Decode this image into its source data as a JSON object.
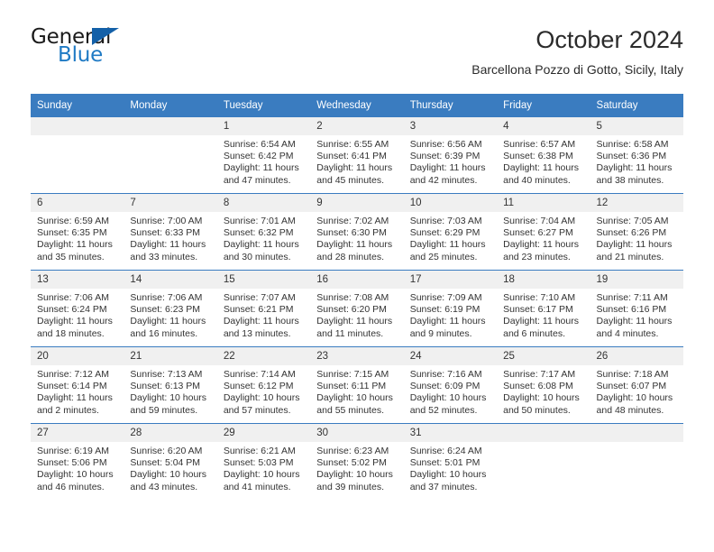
{
  "brand": {
    "word_one": "General",
    "word_two": "Blue",
    "triangle_icon": "triangle-icon",
    "colors": {
      "dark": "#1a1a1a",
      "blue": "#1f7ac4",
      "triangle": "#1360a8"
    }
  },
  "header": {
    "title": "October 2024",
    "subtitle": "Barcellona Pozzo di Gotto, Sicily, Italy"
  },
  "theme": {
    "header_blue": "#3a7cc0",
    "daynum_band": "#f0f0f0",
    "text": "#333333"
  },
  "labels": {
    "sunrise_prefix": "Sunrise:",
    "sunset_prefix": "Sunset:",
    "daylight_prefix": "Daylight:"
  },
  "weekday_headers": [
    "Sunday",
    "Monday",
    "Tuesday",
    "Wednesday",
    "Thursday",
    "Friday",
    "Saturday"
  ],
  "weeks": [
    [
      {
        "day": ""
      },
      {
        "day": ""
      },
      {
        "day": "1",
        "sunrise": "Sunrise: 6:54 AM",
        "sunset": "Sunset: 6:42 PM",
        "daylight_line1": "Daylight: 11 hours",
        "daylight_line2": "and 47 minutes."
      },
      {
        "day": "2",
        "sunrise": "Sunrise: 6:55 AM",
        "sunset": "Sunset: 6:41 PM",
        "daylight_line1": "Daylight: 11 hours",
        "daylight_line2": "and 45 minutes."
      },
      {
        "day": "3",
        "sunrise": "Sunrise: 6:56 AM",
        "sunset": "Sunset: 6:39 PM",
        "daylight_line1": "Daylight: 11 hours",
        "daylight_line2": "and 42 minutes."
      },
      {
        "day": "4",
        "sunrise": "Sunrise: 6:57 AM",
        "sunset": "Sunset: 6:38 PM",
        "daylight_line1": "Daylight: 11 hours",
        "daylight_line2": "and 40 minutes."
      },
      {
        "day": "5",
        "sunrise": "Sunrise: 6:58 AM",
        "sunset": "Sunset: 6:36 PM",
        "daylight_line1": "Daylight: 11 hours",
        "daylight_line2": "and 38 minutes."
      }
    ],
    [
      {
        "day": "6",
        "sunrise": "Sunrise: 6:59 AM",
        "sunset": "Sunset: 6:35 PM",
        "daylight_line1": "Daylight: 11 hours",
        "daylight_line2": "and 35 minutes."
      },
      {
        "day": "7",
        "sunrise": "Sunrise: 7:00 AM",
        "sunset": "Sunset: 6:33 PM",
        "daylight_line1": "Daylight: 11 hours",
        "daylight_line2": "and 33 minutes."
      },
      {
        "day": "8",
        "sunrise": "Sunrise: 7:01 AM",
        "sunset": "Sunset: 6:32 PM",
        "daylight_line1": "Daylight: 11 hours",
        "daylight_line2": "and 30 minutes."
      },
      {
        "day": "9",
        "sunrise": "Sunrise: 7:02 AM",
        "sunset": "Sunset: 6:30 PM",
        "daylight_line1": "Daylight: 11 hours",
        "daylight_line2": "and 28 minutes."
      },
      {
        "day": "10",
        "sunrise": "Sunrise: 7:03 AM",
        "sunset": "Sunset: 6:29 PM",
        "daylight_line1": "Daylight: 11 hours",
        "daylight_line2": "and 25 minutes."
      },
      {
        "day": "11",
        "sunrise": "Sunrise: 7:04 AM",
        "sunset": "Sunset: 6:27 PM",
        "daylight_line1": "Daylight: 11 hours",
        "daylight_line2": "and 23 minutes."
      },
      {
        "day": "12",
        "sunrise": "Sunrise: 7:05 AM",
        "sunset": "Sunset: 6:26 PM",
        "daylight_line1": "Daylight: 11 hours",
        "daylight_line2": "and 21 minutes."
      }
    ],
    [
      {
        "day": "13",
        "sunrise": "Sunrise: 7:06 AM",
        "sunset": "Sunset: 6:24 PM",
        "daylight_line1": "Daylight: 11 hours",
        "daylight_line2": "and 18 minutes."
      },
      {
        "day": "14",
        "sunrise": "Sunrise: 7:06 AM",
        "sunset": "Sunset: 6:23 PM",
        "daylight_line1": "Daylight: 11 hours",
        "daylight_line2": "and 16 minutes."
      },
      {
        "day": "15",
        "sunrise": "Sunrise: 7:07 AM",
        "sunset": "Sunset: 6:21 PM",
        "daylight_line1": "Daylight: 11 hours",
        "daylight_line2": "and 13 minutes."
      },
      {
        "day": "16",
        "sunrise": "Sunrise: 7:08 AM",
        "sunset": "Sunset: 6:20 PM",
        "daylight_line1": "Daylight: 11 hours",
        "daylight_line2": "and 11 minutes."
      },
      {
        "day": "17",
        "sunrise": "Sunrise: 7:09 AM",
        "sunset": "Sunset: 6:19 PM",
        "daylight_line1": "Daylight: 11 hours",
        "daylight_line2": "and 9 minutes."
      },
      {
        "day": "18",
        "sunrise": "Sunrise: 7:10 AM",
        "sunset": "Sunset: 6:17 PM",
        "daylight_line1": "Daylight: 11 hours",
        "daylight_line2": "and 6 minutes."
      },
      {
        "day": "19",
        "sunrise": "Sunrise: 7:11 AM",
        "sunset": "Sunset: 6:16 PM",
        "daylight_line1": "Daylight: 11 hours",
        "daylight_line2": "and 4 minutes."
      }
    ],
    [
      {
        "day": "20",
        "sunrise": "Sunrise: 7:12 AM",
        "sunset": "Sunset: 6:14 PM",
        "daylight_line1": "Daylight: 11 hours",
        "daylight_line2": "and 2 minutes."
      },
      {
        "day": "21",
        "sunrise": "Sunrise: 7:13 AM",
        "sunset": "Sunset: 6:13 PM",
        "daylight_line1": "Daylight: 10 hours",
        "daylight_line2": "and 59 minutes."
      },
      {
        "day": "22",
        "sunrise": "Sunrise: 7:14 AM",
        "sunset": "Sunset: 6:12 PM",
        "daylight_line1": "Daylight: 10 hours",
        "daylight_line2": "and 57 minutes."
      },
      {
        "day": "23",
        "sunrise": "Sunrise: 7:15 AM",
        "sunset": "Sunset: 6:11 PM",
        "daylight_line1": "Daylight: 10 hours",
        "daylight_line2": "and 55 minutes."
      },
      {
        "day": "24",
        "sunrise": "Sunrise: 7:16 AM",
        "sunset": "Sunset: 6:09 PM",
        "daylight_line1": "Daylight: 10 hours",
        "daylight_line2": "and 52 minutes."
      },
      {
        "day": "25",
        "sunrise": "Sunrise: 7:17 AM",
        "sunset": "Sunset: 6:08 PM",
        "daylight_line1": "Daylight: 10 hours",
        "daylight_line2": "and 50 minutes."
      },
      {
        "day": "26",
        "sunrise": "Sunrise: 7:18 AM",
        "sunset": "Sunset: 6:07 PM",
        "daylight_line1": "Daylight: 10 hours",
        "daylight_line2": "and 48 minutes."
      }
    ],
    [
      {
        "day": "27",
        "sunrise": "Sunrise: 6:19 AM",
        "sunset": "Sunset: 5:06 PM",
        "daylight_line1": "Daylight: 10 hours",
        "daylight_line2": "and 46 minutes."
      },
      {
        "day": "28",
        "sunrise": "Sunrise: 6:20 AM",
        "sunset": "Sunset: 5:04 PM",
        "daylight_line1": "Daylight: 10 hours",
        "daylight_line2": "and 43 minutes."
      },
      {
        "day": "29",
        "sunrise": "Sunrise: 6:21 AM",
        "sunset": "Sunset: 5:03 PM",
        "daylight_line1": "Daylight: 10 hours",
        "daylight_line2": "and 41 minutes."
      },
      {
        "day": "30",
        "sunrise": "Sunrise: 6:23 AM",
        "sunset": "Sunset: 5:02 PM",
        "daylight_line1": "Daylight: 10 hours",
        "daylight_line2": "and 39 minutes."
      },
      {
        "day": "31",
        "sunrise": "Sunrise: 6:24 AM",
        "sunset": "Sunset: 5:01 PM",
        "daylight_line1": "Daylight: 10 hours",
        "daylight_line2": "and 37 minutes."
      },
      {
        "day": ""
      },
      {
        "day": ""
      }
    ]
  ]
}
